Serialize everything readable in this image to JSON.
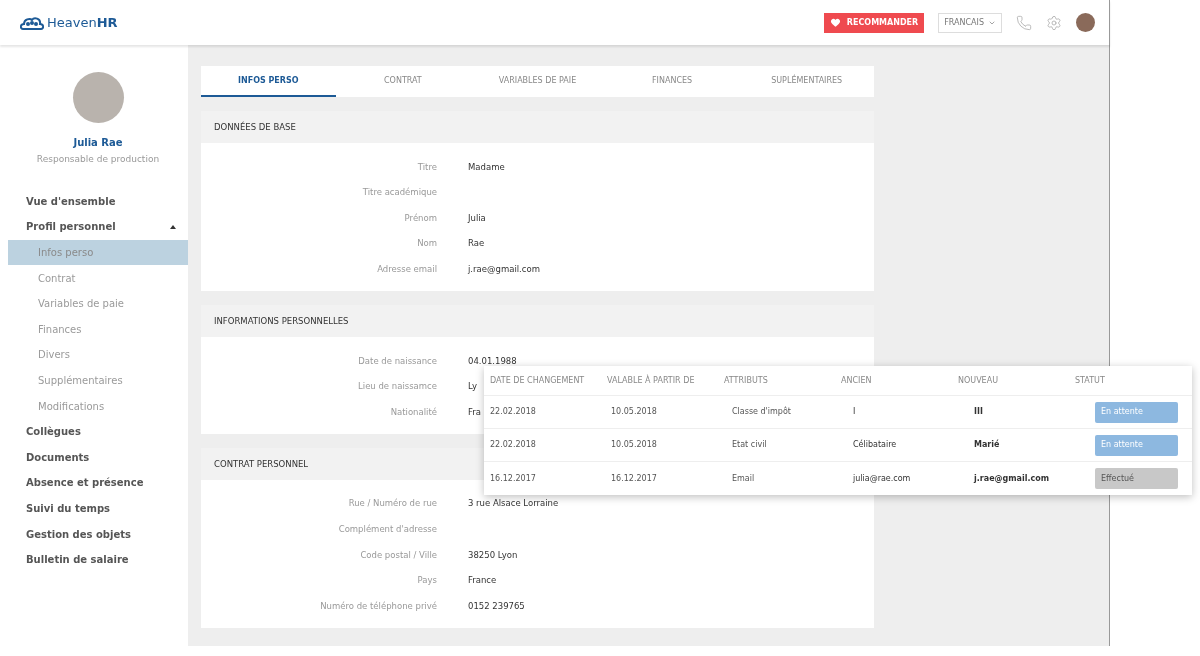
{
  "header": {
    "logo": {
      "light": "Heaven",
      "bold": "HR"
    },
    "recommend_button": "RECOMMANDER",
    "language": "FRANCAIS"
  },
  "profile": {
    "name": "Julia Rae",
    "role": "Responsable de production"
  },
  "sidebar": {
    "items": [
      {
        "label": "Vue d'ensemble",
        "selected": false
      },
      {
        "label": "Profil personnel",
        "selected": false,
        "expanded": true,
        "children": [
          {
            "label": "Infos perso",
            "selected": true
          },
          {
            "label": "Contrat",
            "selected": false
          },
          {
            "label": "Variables de paie",
            "selected": false
          },
          {
            "label": "Finances",
            "selected": false
          },
          {
            "label": "Divers",
            "selected": false
          },
          {
            "label": "Supplémentaires",
            "selected": false
          },
          {
            "label": "Modifications",
            "selected": false
          }
        ]
      },
      {
        "label": "Collègues",
        "selected": false
      },
      {
        "label": "Documents",
        "selected": false
      },
      {
        "label": "Absence et présence",
        "selected": false
      },
      {
        "label": "Suivi du temps",
        "selected": false
      },
      {
        "label": "Gestion des objets",
        "selected": false
      },
      {
        "label": "Bulletin de salaire",
        "selected": false
      }
    ]
  },
  "tabs": [
    {
      "label": "INFOS PERSO",
      "selected": true
    },
    {
      "label": "CONTRAT",
      "selected": false
    },
    {
      "label": "VARIABLES DE PAIE",
      "selected": false
    },
    {
      "label": "FINANCES",
      "selected": false
    },
    {
      "label": "SUPLÉMENTAIRES",
      "selected": false
    }
  ],
  "sections": [
    {
      "title": "DONNÉES DE BASE",
      "fields": [
        {
          "label": "Titre",
          "value": "Madame"
        },
        {
          "label": "Titre académique"
        },
        {
          "label": "Prénom",
          "value": "Julia"
        },
        {
          "label": "Nom",
          "value": "Rae"
        },
        {
          "label": "Adresse email",
          "value": "j.rae@gmail.com"
        }
      ]
    },
    {
      "title": "INFORMATIONS PERSONNELLES",
      "fields": [
        {
          "label": "Date de naissance",
          "value": "04.01.1988"
        },
        {
          "label": "Lieu de naissamce",
          "value": "Ly"
        },
        {
          "label": "Nationalité",
          "value": "Fra"
        }
      ]
    },
    {
      "title": "CONTRAT PERSONNEL",
      "fields": [
        {
          "label": "Rue / Numéro de rue",
          "value": "3 rue Alsace Lorraine"
        },
        {
          "label": "Complément d'adresse"
        },
        {
          "label": "Code postal / Ville",
          "value": "38250 Lyon"
        },
        {
          "label": "Pays",
          "value": "France"
        },
        {
          "label": "Numéro de téléphone privé",
          "value": "0152 239765"
        }
      ]
    }
  ],
  "changes_table": {
    "columns": [
      "DATE DE CHANGEMENT",
      "VALABLE À PARTIR DE",
      "ATTRIBUTS",
      "ANCIEN",
      "NOUVEAU",
      "STATUT"
    ],
    "rows": [
      {
        "cells": [
          "22.02.2018",
          "10.05.2018",
          "Classe d'impôt",
          "I",
          "III"
        ],
        "status": "En attente",
        "kind": "pending"
      },
      {
        "cells": [
          "22.02.2018",
          "10.05.2018",
          "Etat civil",
          "Célibataire",
          "Marié"
        ],
        "status": "En attente",
        "kind": "pending"
      },
      {
        "cells": [
          "16.12.2017",
          "16.12.2017",
          "Email",
          "julia@rae.com",
          "j.rae@gmail.com"
        ],
        "status": "Effectué",
        "kind": "done"
      }
    ]
  }
}
